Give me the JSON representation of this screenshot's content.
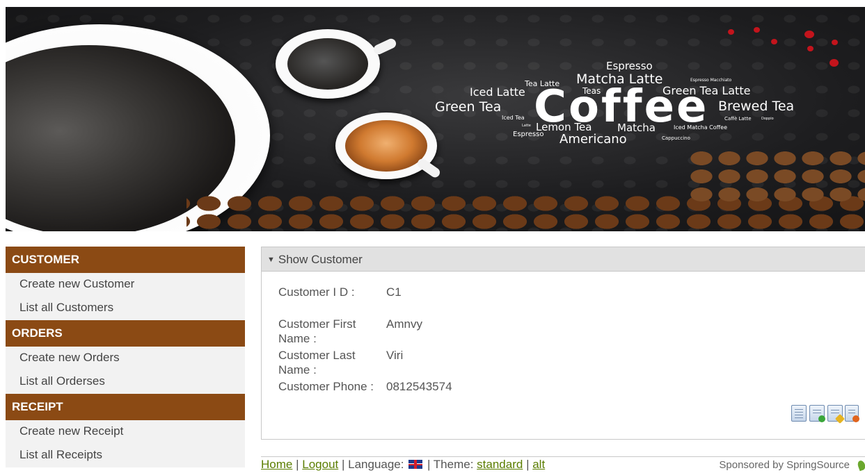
{
  "banner": {
    "title_word": "Coffee",
    "words": {
      "espresso_top": "Espresso",
      "tea_latte": "Tea Latte",
      "matcha_latte": "Matcha Latte",
      "espresso_macchiato": "Espresso Macchiato",
      "iced_latte": "Iced Latte",
      "teas": "Teas",
      "green_tea_latte": "Green Tea Latte",
      "green_tea": "Green Tea",
      "brewed_tea": "Brewed Tea",
      "iced_tea": "Iced Tea",
      "caffe_latte": "Caffè Latte",
      "doppio": "Doppio",
      "lemon_tea": "Lemon Tea",
      "matcha": "Matcha",
      "iced_matcha_coffee": "Iced Matcha Coffee",
      "espresso_bottom": "Espresso",
      "americano": "Americano",
      "cappuccino": "Cappuccino",
      "latte": "Latte"
    }
  },
  "menu": {
    "customer": {
      "header": "CUSTOMER",
      "create": "Create new Customer",
      "list": "List all Customers"
    },
    "orders": {
      "header": "ORDERS",
      "create": "Create new Orders",
      "list": "List all Orderses"
    },
    "receipt": {
      "header": "RECEIPT",
      "create": "Create new Receipt",
      "list": "List all Receipts"
    }
  },
  "panel": {
    "title": "Show Customer",
    "fields": {
      "id_label": "Customer I D :",
      "id_value": "C1",
      "first_label_1": "Customer First",
      "first_label_2": "Name :",
      "first_value": "Amnvy",
      "last_label_1": "Customer Last",
      "last_label_2": "Name :",
      "last_value": "Viri",
      "phone_label": "Customer Phone :",
      "phone_value": "0812543574"
    },
    "actions": [
      "list-icon",
      "create-icon",
      "update-icon",
      "delete-icon"
    ]
  },
  "footer": {
    "home": "Home",
    "sep1": "|",
    "logout": "Logout",
    "language_label": "| Language:",
    "theme_label": "| Theme:",
    "theme_standard": "standard",
    "sep2": "|",
    "theme_alt": "alt",
    "sponsor": "Sponsored by SpringSource"
  },
  "colors": {
    "menu_header": "#8b4a14",
    "menu_item_bg": "#f2f2f2",
    "panel_title_bg": "#e1e1e1",
    "link": "#5a7d00"
  }
}
